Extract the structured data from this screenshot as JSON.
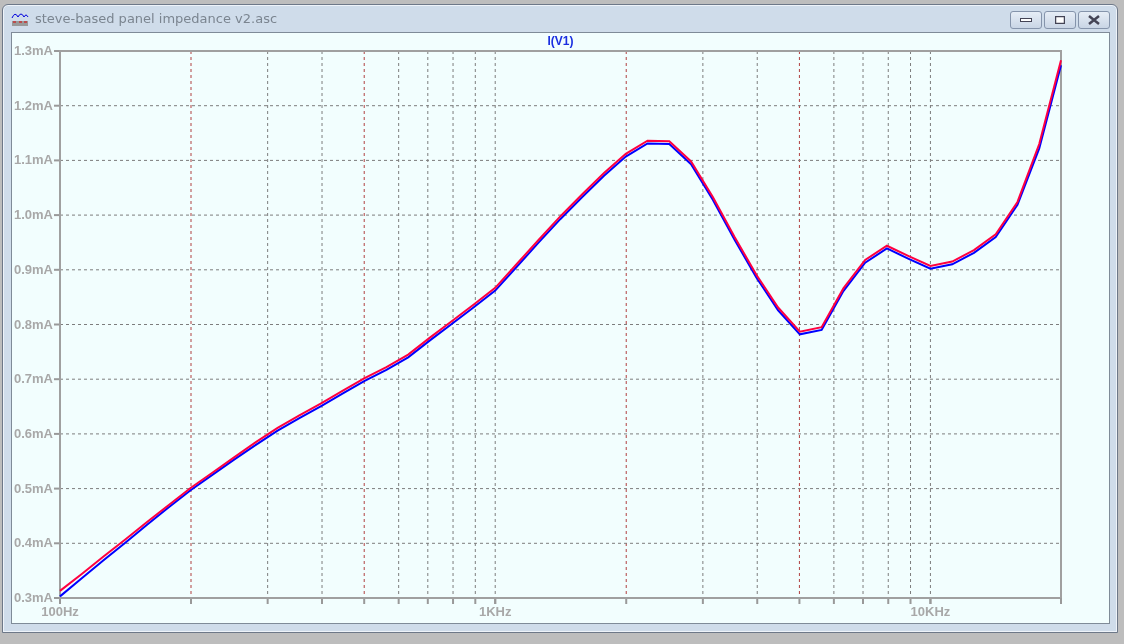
{
  "window": {
    "title": "steve-based panel impedance v2.asc"
  },
  "plot": {
    "chart_data": {
      "type": "line",
      "title": "I(V1)",
      "categories": [
        "100Hz",
        null,
        null,
        null,
        null,
        null,
        null,
        null,
        null,
        null,
        null,
        null,
        null,
        null,
        null,
        null,
        null,
        null,
        null,
        null,
        "1KHz",
        null,
        null,
        null,
        null,
        null,
        null,
        null,
        null,
        null,
        null,
        null,
        null,
        null,
        null,
        null,
        null,
        null,
        null,
        null,
        "10KHz",
        null,
        null,
        null,
        null,
        null,
        null
      ],
      "series": [
        {
          "color": "#0000ff",
          "values": [
            0.303,
            0.336,
            0.369,
            0.401,
            0.434,
            0.466,
            0.497,
            0.525,
            0.553,
            0.58,
            0.606,
            0.629,
            0.651,
            0.674,
            0.697,
            0.717,
            0.74,
            0.771,
            0.801,
            0.831,
            0.862,
            0.906,
            0.95,
            0.993,
            1.033,
            1.072,
            1.107,
            1.131,
            1.13,
            1.093,
            1.028,
            0.955,
            0.886,
            0.826,
            0.782,
            0.79,
            0.861,
            0.913,
            0.939,
            0.92,
            0.902,
            0.91,
            0.931,
            0.96,
            1.019,
            1.122,
            1.274
          ]
        },
        {
          "color": "#ff0040",
          "values": [
            0.313,
            0.344,
            0.376,
            0.407,
            0.439,
            0.47,
            0.501,
            0.529,
            0.557,
            0.585,
            0.611,
            0.634,
            0.656,
            0.679,
            0.702,
            0.722,
            0.745,
            0.776,
            0.806,
            0.836,
            0.867,
            0.911,
            0.955,
            0.998,
            1.038,
            1.077,
            1.112,
            1.136,
            1.135,
            1.098,
            1.033,
            0.96,
            0.891,
            0.831,
            0.787,
            0.795,
            0.866,
            0.918,
            0.944,
            0.925,
            0.907,
            0.915,
            0.936,
            0.965,
            1.024,
            1.13,
            1.283
          ]
        }
      ],
      "grid": true,
      "ylim": [
        0.3,
        1.3
      ],
      "yticks": [
        {
          "value": 0.3,
          "label": "0.3mA"
        },
        {
          "value": 0.4,
          "label": "0.4mA"
        },
        {
          "value": 0.5,
          "label": "0.5mA"
        },
        {
          "value": 0.6,
          "label": "0.6mA"
        },
        {
          "value": 0.7,
          "label": "0.7mA"
        },
        {
          "value": 0.8,
          "label": "0.8mA"
        },
        {
          "value": 0.9,
          "label": "0.9mA"
        },
        {
          "value": 1.0,
          "label": "1.0mA"
        },
        {
          "value": 1.1,
          "label": "1.1mA"
        },
        {
          "value": 1.2,
          "label": "1.2mA"
        },
        {
          "value": 1.3,
          "label": "1.3mA"
        }
      ]
    }
  }
}
